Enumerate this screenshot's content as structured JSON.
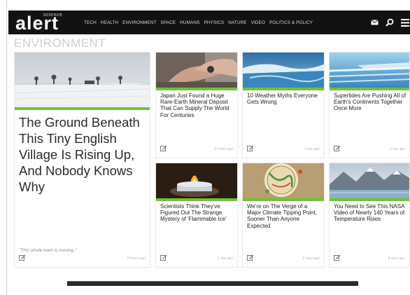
{
  "nav": {
    "logo_small": "science",
    "logo_main": "alert",
    "links": [
      "TECH",
      "HEALTH",
      "ENVIRONMENT",
      "SPACE",
      "HUMANS",
      "PHYSICS",
      "NATURE",
      "VIDEO",
      "POLITICS & POLICY"
    ],
    "icons": [
      "mail-icon",
      "search-icon",
      "menu-icon"
    ]
  },
  "section": {
    "title": "ENVIRONMENT"
  },
  "feature": {
    "headline": "The Ground Beneath This Tiny English Village Is Rising Up, And Nobody Knows Why",
    "subtitle": "\"This whole town is moving.\"",
    "time": "8 hours ago"
  },
  "cards": [
    {
      "headline": "Japan Just Found a Huge Rare-Earth Mineral Deposit That Can Supply The World For Centuries",
      "time": "8 hours ago"
    },
    {
      "headline": "10 Weather Myths Everyone Gets Wrong",
      "time": "1 day ago"
    },
    {
      "headline": "Supertides Are Pushing All of Earth's Continents Together Once More",
      "time": "1 day ago"
    },
    {
      "headline": "Scientists Think They've Figured Out The Strange Mystery of 'Flammable Ice'",
      "time": "1 day ago"
    },
    {
      "headline": "We're on The Verge of a Major Climate Tipping Point, Sooner Than Anyone Expected",
      "time": "8 days ago"
    },
    {
      "headline": "You Need to See This NASA Video of Nearly 140 Years of Temperature Rises",
      "time": "8 days ago"
    }
  ],
  "colors": {
    "nav_bg": "#121212",
    "accent_green": "#6fc23a",
    "section_title": "#cfcfcf"
  }
}
